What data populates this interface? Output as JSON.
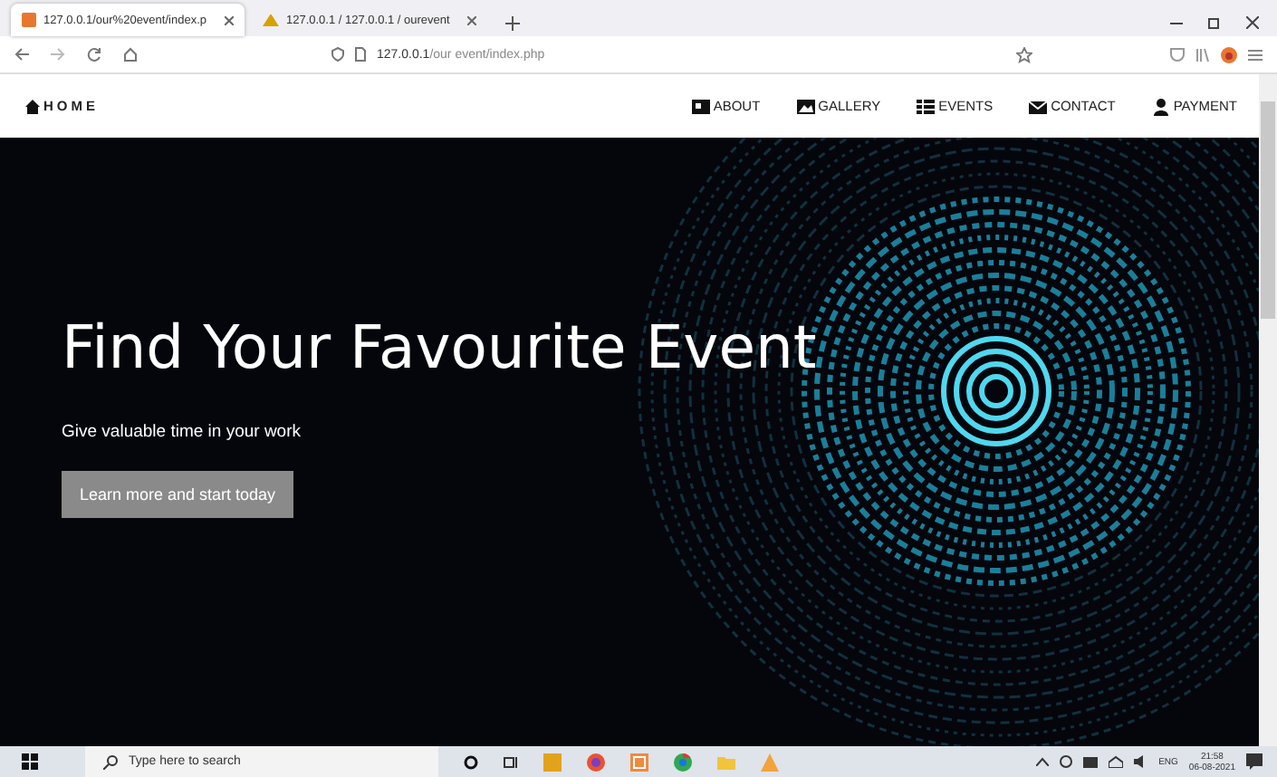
{
  "browser": {
    "tabs": [
      {
        "title": "127.0.0.1/our%20event/index.p",
        "selected": true
      },
      {
        "title": "127.0.0.1 / 127.0.0.1 / ourevent",
        "selected": false
      }
    ],
    "url_host": "127.0.0.1",
    "url_path": "/our event/index.php"
  },
  "nav": {
    "brand": "HOME",
    "links": [
      {
        "label": "ABOUT"
      },
      {
        "label": "GALLERY"
      },
      {
        "label": "EVENTS"
      },
      {
        "label": "CONTACT"
      },
      {
        "label": "PAYMENT"
      }
    ]
  },
  "hero": {
    "title": "Find Your Favourite Event",
    "subtitle": "Give valuable time in your work",
    "button": "Learn more and start today"
  },
  "taskbar": {
    "search_placeholder": "Type here to search",
    "language": "ENG",
    "time": "21:58",
    "date": "06-08-2021"
  }
}
